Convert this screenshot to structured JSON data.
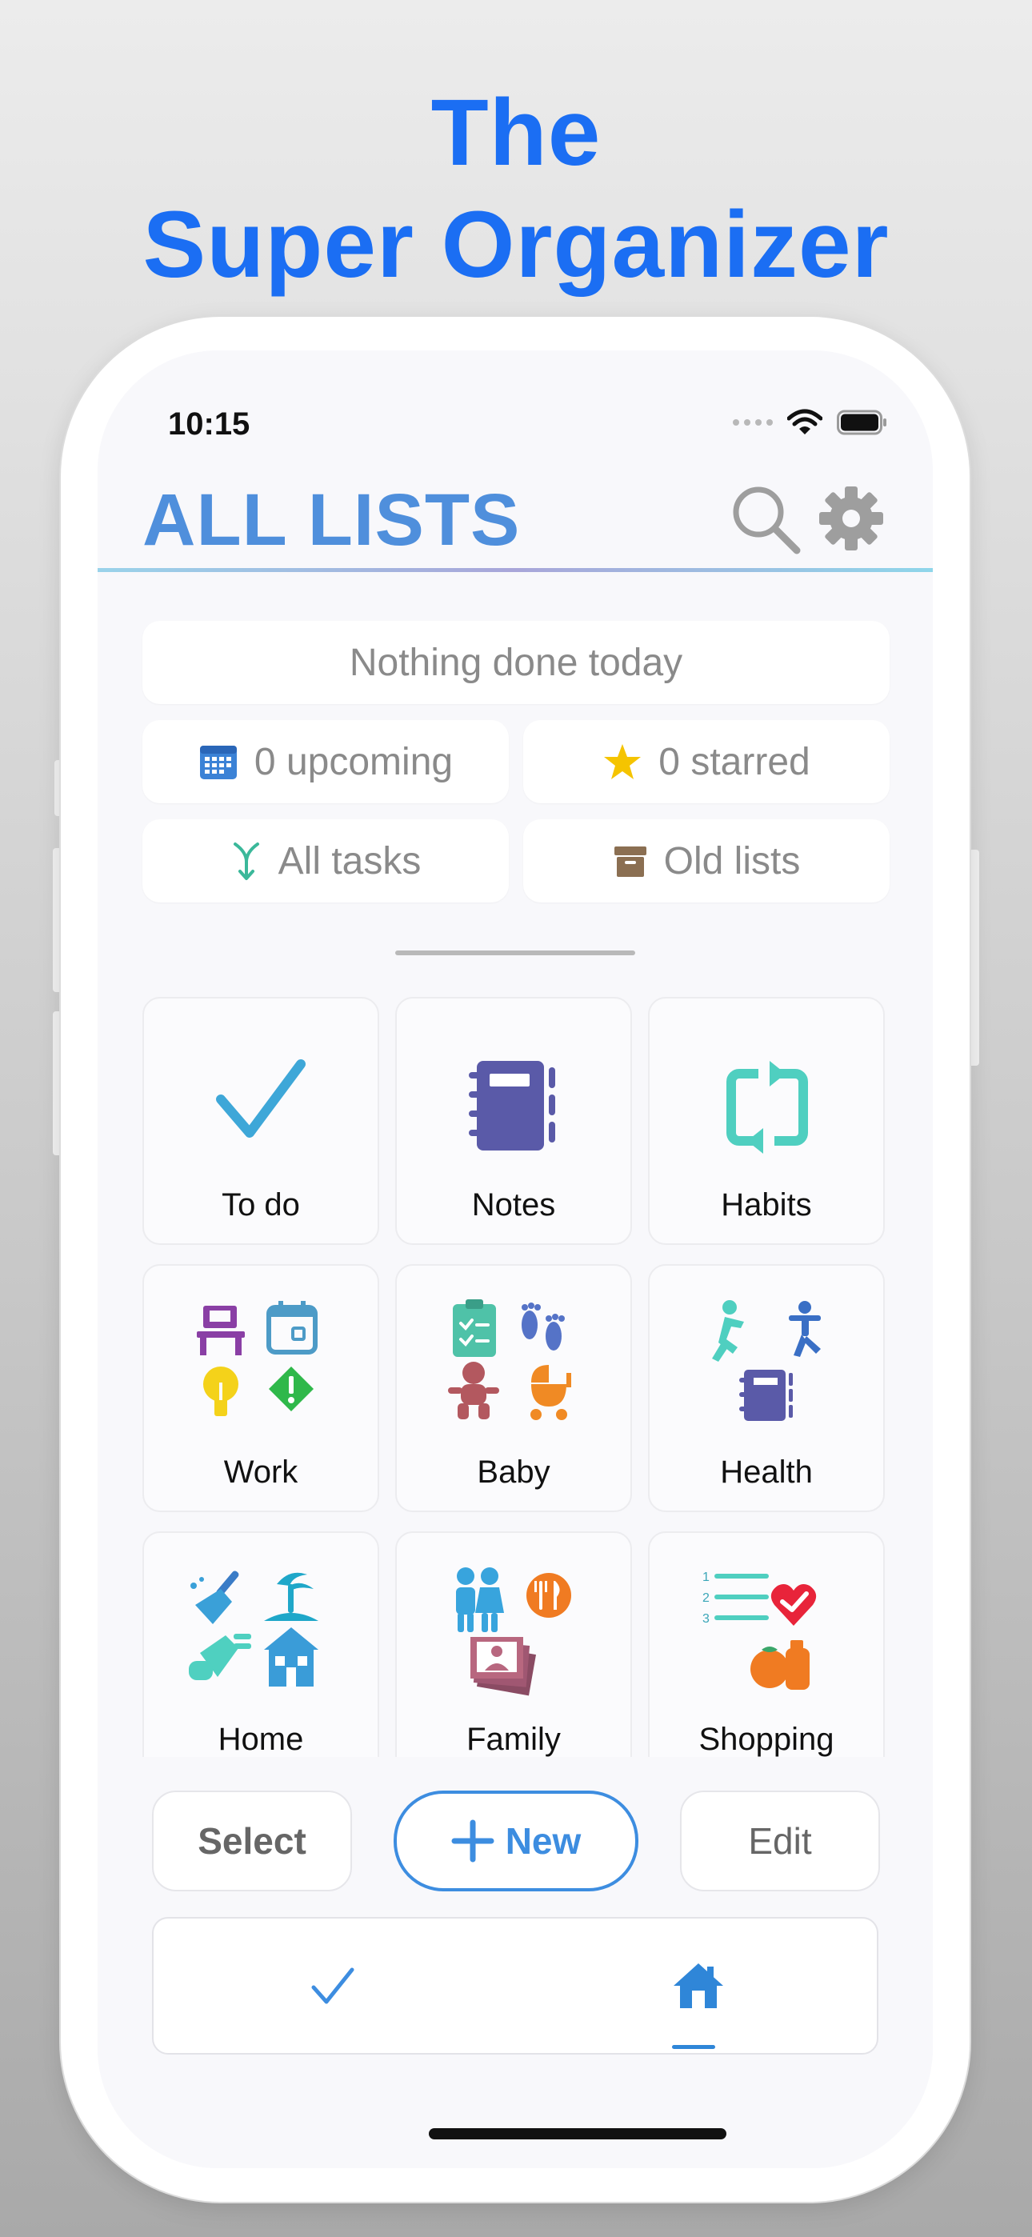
{
  "promo": {
    "line1": "The",
    "line2": "Super Organizer"
  },
  "status_bar": {
    "time": "10:15"
  },
  "header": {
    "title": "ALL LISTS"
  },
  "summary": {
    "today": "Nothing done today",
    "upcoming": "0 upcoming",
    "starred": "0 starred",
    "all_tasks": "All tasks",
    "old_lists": "Old lists"
  },
  "lists": [
    {
      "label": "To do"
    },
    {
      "label": "Notes"
    },
    {
      "label": "Habits"
    },
    {
      "label": "Work"
    },
    {
      "label": "Baby"
    },
    {
      "label": "Health"
    },
    {
      "label": "Home"
    },
    {
      "label": "Family"
    },
    {
      "label": "Shopping"
    }
  ],
  "actions": {
    "select": "Select",
    "new": "New",
    "edit": "Edit"
  },
  "colors": {
    "accent": "#3d8de0",
    "title_blue": "#1b6ef3",
    "header_blue": "#4f8fdc"
  }
}
